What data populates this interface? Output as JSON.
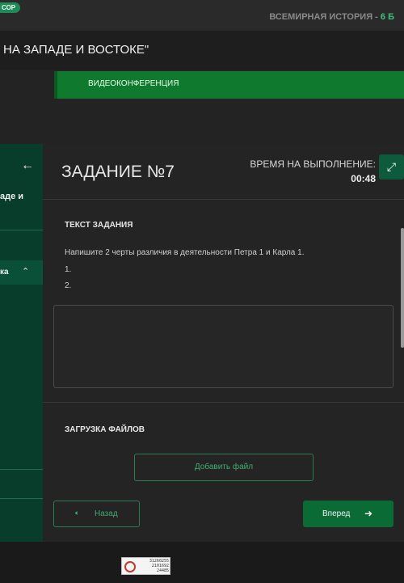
{
  "header": {
    "badge": "СОР",
    "subject": "ВСЕМИРНАЯ ИСТОРИЯ - ",
    "grade": "6 Б",
    "page_title": "НА ЗАПАДЕ И ВОСТОКЕ\""
  },
  "video": {
    "label": "ВИДЕОКОНФЕРЕНЦИЯ"
  },
  "sidebar": {
    "items": [
      {
        "label": "аде и"
      },
      {
        "label": "ка"
      }
    ]
  },
  "task": {
    "title": "ЗАДАНИЕ №7",
    "time_label": "ВРЕМЯ НА ВЫПОЛНЕНИЕ:",
    "time_value": "00:48",
    "text_heading": "ТЕКСТ ЗАДАНИЯ",
    "text": "Напишите 2 черты различия в деятельности Петра 1 и Карла 1.",
    "list": [
      "1.",
      "2."
    ],
    "answer_value": "",
    "upload_heading": "ЗАГРУЗКА ФАЙЛОВ",
    "add_file": "Добавить файл"
  },
  "nav": {
    "back": "Назад",
    "next": "Вперед"
  },
  "watermark": {
    "lines": [
      "31260255",
      "2101692",
      "24485"
    ]
  },
  "icons": {
    "back_arrow": "arrow-left-icon",
    "expand": "expand-arrows-icon",
    "chevron": "chevron-up-icon",
    "next_arrow": "arrow-right-icon"
  },
  "colors": {
    "accent_green": "#3fae72",
    "video_bar": "#0f7a2e",
    "sidebar": "#083d2b",
    "next_button": "#0b6b34"
  }
}
